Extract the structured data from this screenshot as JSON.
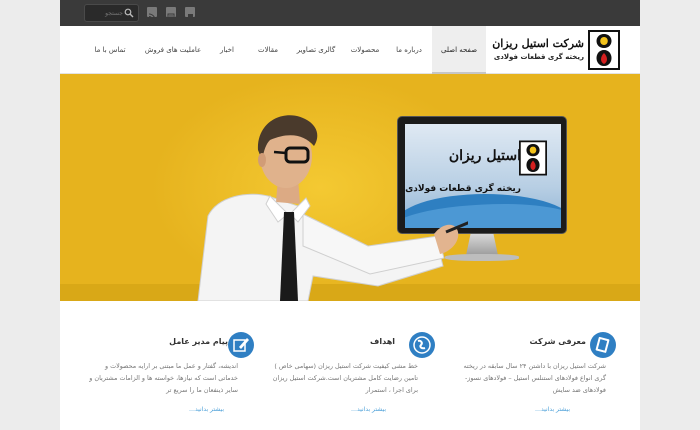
{
  "topbar": {
    "search_placeholder": "جستجو",
    "icons": [
      "search-icon",
      "rss-icon",
      "facebook-icon",
      "blog-icon"
    ]
  },
  "header": {
    "brand_title": "شرکت استیل ریزان",
    "brand_subtitle": "ریخته گری قطعات فولادی",
    "nav": [
      "صفحه اصلی",
      "درباره ما",
      "محصولات",
      "گالری تصاویر",
      "مقالات",
      "اخبار",
      "عاملیت های فروش",
      "تماس با ما"
    ],
    "active_index": 0
  },
  "hero": {
    "screen_title": "استیل ریزان",
    "screen_subtitle": "ریخته گری قطعات فولادی"
  },
  "columns": [
    {
      "icon": "book-icon",
      "title": "معرفی شرکت",
      "text": "شرکت استیل ریزان با داشتن ۲۴ سال سابقه در ریخته گری انواع فولادهای استنلس استیل – فولادهای نسوز- فولادهای ضد سایش",
      "more": "بیشتر بدانید…"
    },
    {
      "icon": "globe-icon",
      "title": "اهداف",
      "text": "خط مشی کیفیت شرکت استیل ریزان (سهامی خاص ) تامین رضایت کامل مشتریان است.شرکت استیل ریزان برای اجرا ، استمرار",
      "more": "بیشتر بدانید…"
    },
    {
      "icon": "pencil-icon",
      "title": "پیام مدیر عامل",
      "text": "اندیشه، گفتار و عمل ما مبتنی بر ارایه محصولات و خدماتی است که نیازها، خواسته ها و الزامات مشتریان و سایر ذینفعان ما را سریع تر",
      "more": "بیشتر بدانید…"
    }
  ],
  "colors": {
    "topbar": "#3a3a3a",
    "hero": "#e6b31e",
    "accent_blue": "#2f7fc3",
    "link": "#4a9fd8"
  }
}
